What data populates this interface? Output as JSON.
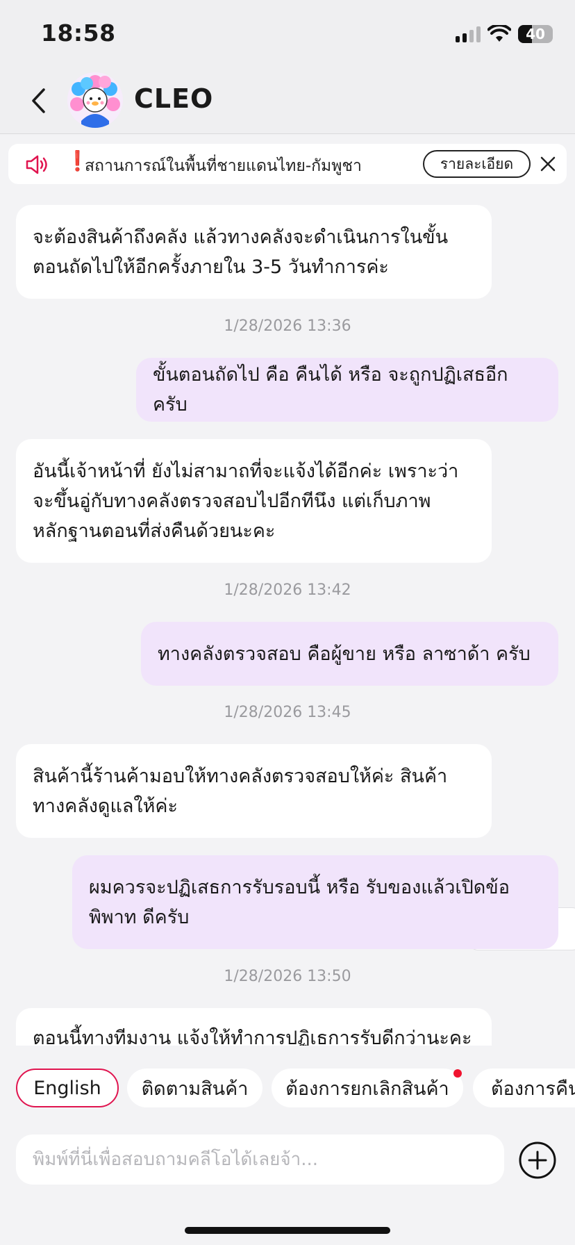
{
  "status_bar": {
    "time": "18:58",
    "battery": "40"
  },
  "header": {
    "title": "CLEO",
    "back_icon": "chevron-left-icon",
    "avatar_icon": "flower-cat-mascot-icon"
  },
  "notice": {
    "text": "สถานการณ์ในพื้นที่ชายแดนไทย-กัมพูชา",
    "alert_mark": "❗",
    "detail_button": "รายละเอียด",
    "speaker_icon": "speaker-icon",
    "close_icon": "close-icon"
  },
  "messages": [
    {
      "sender": "agent",
      "lines": [
        "จะต้องสินค้าถึงคลัง แล้วทางคลังจะดำเนินการในขั้น",
        "ตอนถัดไปให้อีกครั้งภายใน 3-5 วันทำการค่ะ"
      ]
    },
    {
      "timestamp": "1/28/2026 13:36"
    },
    {
      "sender": "user",
      "lines": [
        "ขั้นตอนถัดไป คือ คืนได้ หรือ จะถูกปฏิเสธอีกครับ"
      ]
    },
    {
      "sender": "agent",
      "lines": [
        "อันนี้เจ้าหน้าที่  ยังไม่สามาถที่จะแจ้งได้อีกค่ะ  เพราะว่า",
        "จะขึ้นอู่กับทางคลังตรวจสอบไปอีกทีนึง  แต่เก็บภาพ",
        "หลักฐานตอนที่ส่งคืนด้วยนะคะ"
      ]
    },
    {
      "timestamp": "1/28/2026 13:42"
    },
    {
      "sender": "user",
      "lines": [
        "ทางคลังตรวจสอบ  คือผู้ขาย  หรือ ลาซาด้า ครับ"
      ]
    },
    {
      "timestamp": "1/28/2026 13:45"
    },
    {
      "sender": "agent",
      "lines": [
        "สินค้านี้ร้านค้ามอบให้ทางคลังตรวจสอบให้ค่ะ  สินค้า",
        "ทางคลังดูแลให้ค่ะ"
      ]
    },
    {
      "sender": "user",
      "lines": [
        "ผมควรจะปฏิเสธการรับรอบนี้   หรือ  รับของแล้วเปิดข้อ",
        "พิพาท ดีครับ"
      ]
    },
    {
      "timestamp": "1/28/2026 13:50"
    },
    {
      "sender": "agent",
      "lines": [
        "ตอนนี้ทางทีมงาน แจ้งให้ทำการปฏิเธการรับดีกว่านะคะ"
      ]
    }
  ],
  "quick_replies": [
    "English",
    "ติดตามสินค้า",
    "ต้องการยกเลิกสินค้า",
    "ต้องการคืน"
  ],
  "composer": {
    "placeholder": "พิมพ์ที่นี่เพื่อสอบถามคลีโอได้เลยจ้า...",
    "value": "",
    "add_icon": "plus-circle-icon"
  },
  "colors": {
    "user_bubble": "#f1e4fb",
    "agent_bubble": "#ffffff",
    "accent": "#e0144f",
    "alert": "#e0102f"
  }
}
